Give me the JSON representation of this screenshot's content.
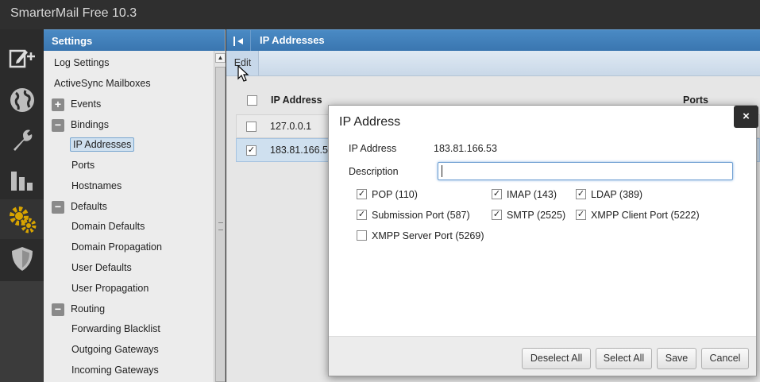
{
  "app": {
    "title": "SmarterMail Free 10.3"
  },
  "iconbar": {
    "icons": [
      "compose-icon",
      "globe-icon",
      "wrench-icon",
      "reports-icon",
      "settings-gears-icon",
      "shield-icon"
    ]
  },
  "settings_panel": {
    "title": "Settings",
    "items": [
      {
        "label": "Log Settings",
        "level": 0
      },
      {
        "label": "ActiveSync Mailboxes",
        "level": 0
      },
      {
        "label": "Events",
        "level": 0,
        "toggle": "+"
      },
      {
        "label": "Bindings",
        "level": 0,
        "toggle": "−"
      },
      {
        "label": "IP Addresses",
        "level": 1,
        "selected": true
      },
      {
        "label": "Ports",
        "level": 1
      },
      {
        "label": "Hostnames",
        "level": 1
      },
      {
        "label": "Defaults",
        "level": 0,
        "toggle": "−"
      },
      {
        "label": "Domain Defaults",
        "level": 1
      },
      {
        "label": "Domain Propagation",
        "level": 1
      },
      {
        "label": "User Defaults",
        "level": 1
      },
      {
        "label": "User Propagation",
        "level": 1
      },
      {
        "label": "Routing",
        "level": 0,
        "toggle": "−"
      },
      {
        "label": "Forwarding Blacklist",
        "level": 1
      },
      {
        "label": "Outgoing Gateways",
        "level": 1
      },
      {
        "label": "Incoming Gateways",
        "level": 1
      }
    ]
  },
  "main": {
    "title": "IP Addresses",
    "toolbar": {
      "edit_label": "Edit"
    },
    "grid": {
      "columns": [
        "IP Address",
        "Ports"
      ],
      "rows": [
        {
          "ip": "127.0.0.1",
          "checked": false
        },
        {
          "ip": "183.81.166.5",
          "checked": true
        }
      ]
    }
  },
  "dialog": {
    "title": "IP Address",
    "close_label": "×",
    "ip_label": "IP Address",
    "ip_value": "183.81.166.53",
    "description_label": "Description",
    "description_value": "",
    "ports": [
      {
        "label": "POP (110)",
        "checked": true
      },
      {
        "label": "IMAP (143)",
        "checked": true
      },
      {
        "label": "LDAP (389)",
        "checked": true
      },
      {
        "label": "Submission Port (587)",
        "checked": true
      },
      {
        "label": "SMTP (2525)",
        "checked": true
      },
      {
        "label": "XMPP Client Port (5222)",
        "checked": true
      },
      {
        "label": "XMPP Server Port (5269)",
        "checked": false
      }
    ],
    "buttons": {
      "deselect_all": "Deselect All",
      "select_all": "Select All",
      "save": "Save",
      "cancel": "Cancel"
    }
  },
  "colors": {
    "accent": "#3a76b0",
    "gear": "#d8a400"
  }
}
